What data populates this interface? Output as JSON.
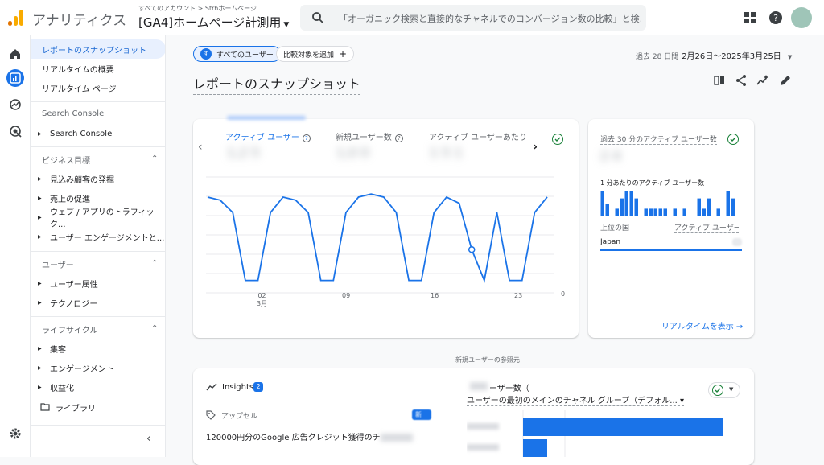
{
  "topbar": {
    "app_title": "アナリティクス",
    "account_path": "すべてのアカウント > Strhホームページ",
    "property_name": "[GA4]ホームページ計測用",
    "search_placeholder": "「オーガニック検索と直接的なチャネルでのコンバージョン数の比較」と検…",
    "icons": [
      "apps-icon",
      "help-icon",
      "avatar"
    ]
  },
  "sidebar": {
    "items_top": [
      "レポートのスナップショット",
      "リアルタイムの概要",
      "リアルタイム ページ"
    ],
    "search_console_header": "Search Console",
    "search_console_item": "Search Console",
    "business_header": "ビジネス目標",
    "business_items": [
      "見込み顧客の発掘",
      "売上の促進",
      "ウェブ / アプリのトラフィック...",
      "ユーザー エンゲージメントと..."
    ],
    "user_header": "ユーザー",
    "user_items": [
      "ユーザー属性",
      "テクノロジー"
    ],
    "lifecycle_header": "ライフサイクル",
    "lifecycle_items": [
      "集客",
      "エンゲージメント",
      "収益化"
    ],
    "library_label": "ライブラリ"
  },
  "toolbar": {
    "all_users_badge": "す",
    "all_users_label": "すべてのユーザー",
    "add_comparison": "比較対象を追加",
    "date_prefix": "過去 28 日間",
    "date_range": "2月26日～2025年3月25日"
  },
  "page_title": "レポートのスナップショット",
  "main_card": {
    "tabs": [
      "アクティブ ユーザー",
      "新規ユーザー数",
      "アクティブ ユーザーあたりの"
    ],
    "x_ticks": [
      "02",
      "09",
      "16",
      "23"
    ],
    "x_month": "3月",
    "y_zero": "0"
  },
  "chart_data": {
    "type": "line",
    "x": [
      "02/26",
      "02/27",
      "02/28",
      "03/01",
      "03/02",
      "03/03",
      "03/04",
      "03/05",
      "03/06",
      "03/07",
      "03/08",
      "03/09",
      "03/10",
      "03/11",
      "03/12",
      "03/13",
      "03/14",
      "03/15",
      "03/16",
      "03/17",
      "03/18",
      "03/19",
      "03/20",
      "03/21",
      "03/22",
      "03/23",
      "03/24",
      "03/25"
    ],
    "series": [
      {
        "values": [
          62,
          60,
          52,
          8,
          8,
          52,
          62,
          60,
          52,
          8,
          8,
          52,
          62,
          64,
          62,
          52,
          8,
          8,
          52,
          62,
          58,
          28,
          8,
          52,
          8,
          8,
          52,
          62
        ]
      }
    ],
    "ylim": [
      0,
      75
    ],
    "xlabel": "",
    "ylabel": ""
  },
  "realtime_card": {
    "title": "過去 30 分のアクティブ ユーザー数",
    "per_minute": "1 分あたりのアクティブ ユーザー数",
    "col_country": "上位の国",
    "col_users": "アクティブ ユーザー",
    "country": "Japan",
    "link": "リアルタイムを表示",
    "bars": [
      1,
      0.5,
      0,
      0.3,
      0.7,
      1,
      1,
      0.7,
      0,
      0.3,
      0.3,
      0.3,
      0.3,
      0.3,
      0,
      0.3,
      0,
      0.3,
      0,
      0,
      0.7,
      0.3,
      0.7,
      0,
      0.3,
      0,
      1,
      0.7
    ]
  },
  "lower": {
    "section_label": "新規ユーザーの参照元",
    "insights_label": "Insights",
    "insights_count": "2",
    "tag_label": "アップセル",
    "new_badge": "新",
    "insight_text": "120000円分のGoogle 広告クレジット獲得のチ",
    "users_label": "ーザー数（",
    "channel_label": "ユーザーの最初のメインのチャネル グループ（デフォル... ▾"
  }
}
